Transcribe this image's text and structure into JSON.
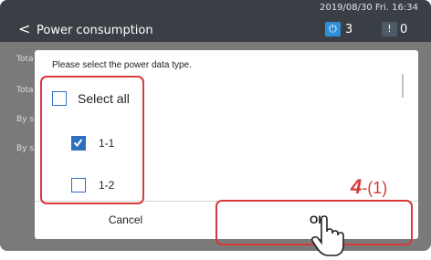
{
  "header": {
    "back_glyph": "<",
    "title": "Power consumption",
    "datetime": "2019/08/30 Fri. 16:34",
    "status": [
      {
        "icon": "power-icon",
        "glyph": "⏻",
        "count": "3",
        "color": "#2e8fd8"
      },
      {
        "icon": "warning-icon",
        "glyph": "!",
        "count": "0",
        "color": "#4d5a66"
      }
    ]
  },
  "background_list": [
    "Tota",
    "Tota",
    "By s",
    "By s"
  ],
  "dialog": {
    "title": "Please select the power data type.",
    "options": [
      {
        "label": "Select all",
        "checked": false
      },
      {
        "label": "1-1",
        "checked": true
      },
      {
        "label": "1-2",
        "checked": false
      }
    ],
    "cancel_label": "Cancel",
    "ok_label": "OK"
  },
  "annotation": {
    "step_number": "4",
    "step_sub": "-(1)"
  },
  "colors": {
    "highlight": "#d63a3a",
    "checkbox": "#2f6fbf",
    "header_bg": "#3a3f45"
  }
}
